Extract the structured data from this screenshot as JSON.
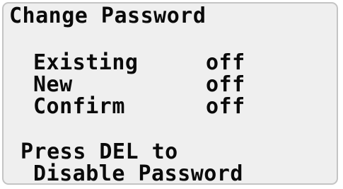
{
  "screen": {
    "title": "Change Password",
    "rows": [
      {
        "label": "Existing",
        "value": "off"
      },
      {
        "label": "New",
        "value": "off"
      },
      {
        "label": "Confirm",
        "value": "off"
      }
    ],
    "message": {
      "line1": "Press DEL to",
      "line2": "Disable Password"
    }
  },
  "colors": {
    "panel_background": "#efefef",
    "panel_border": "#c4c4c4",
    "text": "#0a0a0a"
  }
}
